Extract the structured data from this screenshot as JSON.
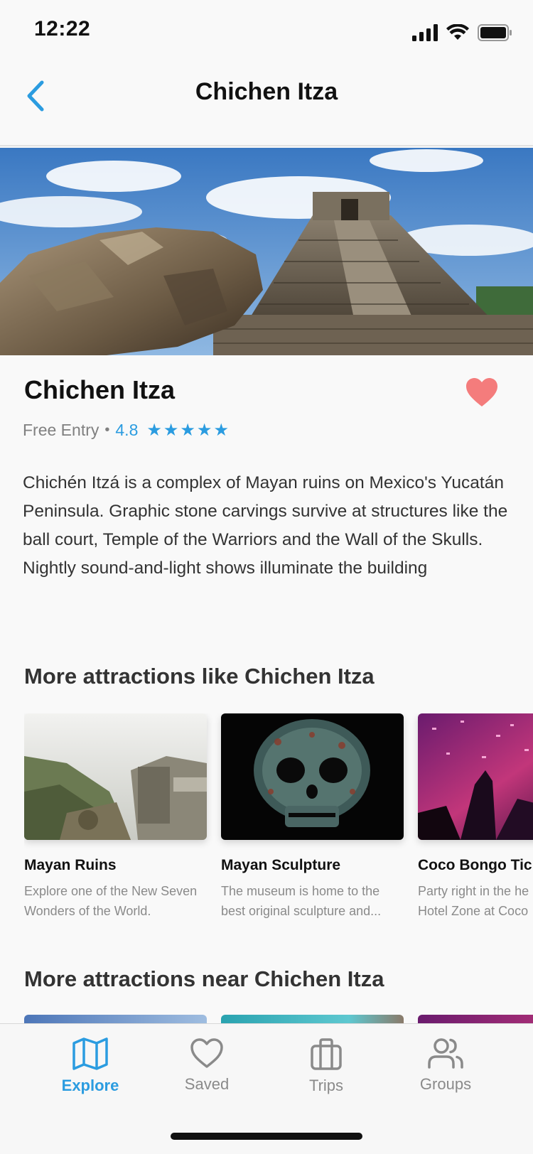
{
  "status_bar": {
    "time": "12:22"
  },
  "nav": {
    "title": "Chichen Itza"
  },
  "place": {
    "title": "Chichen Itza",
    "entry": "Free Entry",
    "separator": "•",
    "rating": "4.8",
    "stars": 5,
    "description": "Chichén Itzá is a complex of Mayan ruins on Mexico's Yucatán Peninsula. Graphic stone carvings survive at structures like the ball court, Temple of the Warriors and the Wall of the Skulls. Nightly sound-and-light shows illuminate the building",
    "favorite_color": "#f47c7c"
  },
  "sections": {
    "similar_title": "More attractions like Chichen Itza",
    "near_title": "More attractions near Chichen Itza"
  },
  "similar": [
    {
      "title": "Mayan Ruins",
      "desc_line1": "Explore one of the New Seven",
      "desc_line2": "Wonders of the World."
    },
    {
      "title": "Mayan Sculpture",
      "desc_line1": "The museum is home to the",
      "desc_line2": "best original sculpture and..."
    },
    {
      "title": "Coco Bongo Tic",
      "desc_line1": "Party right in the he",
      "desc_line2": "Hotel Zone at Coco"
    }
  ],
  "tabs": [
    {
      "label": "Explore",
      "icon": "map-icon",
      "active": true
    },
    {
      "label": "Saved",
      "icon": "heart-outline-icon",
      "active": false
    },
    {
      "label": "Trips",
      "icon": "briefcase-icon",
      "active": false
    },
    {
      "label": "Groups",
      "icon": "users-icon",
      "active": false
    }
  ],
  "colors": {
    "accent": "#2b9ce0",
    "favorite": "#f47c7c",
    "muted": "#8a8a8a"
  }
}
